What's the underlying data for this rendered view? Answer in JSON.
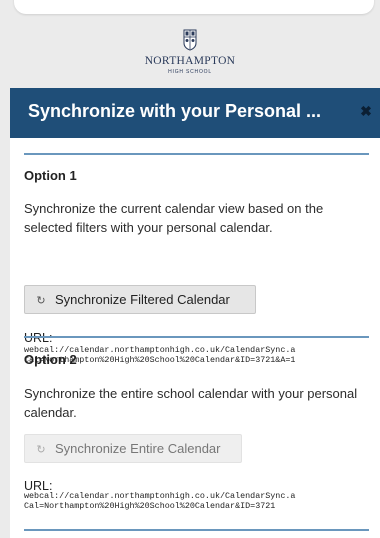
{
  "top_bar": {},
  "logo": {
    "name": "NORTHAMPTON",
    "subtitle": "HIGH SCHOOL",
    "color": "#2a3a5a"
  },
  "modal": {
    "title": "Synchronize with your Personal ...",
    "close_icon": "close-x",
    "header_color": "#1f4e78",
    "rule_color": "#6a97bd"
  },
  "option1": {
    "heading": "Option 1",
    "description": "Synchronize the current calendar view based on the selected filters with your personal calendar.",
    "button_icon": "sync-icon",
    "button_label": "Synchronize Filtered Calendar",
    "url_label": "URL:",
    "url_line1": "webcal://calendar.northamptonhigh.co.uk/CalendarSync.a",
    "url_line2": "Cal=Northampton%20High%20School%20Calendar&ID=3721&A=1"
  },
  "option2": {
    "heading": "Option 2",
    "description": "Synchronize the entire school calendar with your personal calendar.",
    "button_icon": "sync-icon",
    "button_label": "Synchronize Entire Calendar",
    "button_disabled": true,
    "url_label": "URL:",
    "url_line1": "webcal://calendar.northamptonhigh.co.uk/CalendarSync.a",
    "url_line2": "Cal=Northampton%20High%20School%20Calendar&ID=3721"
  }
}
